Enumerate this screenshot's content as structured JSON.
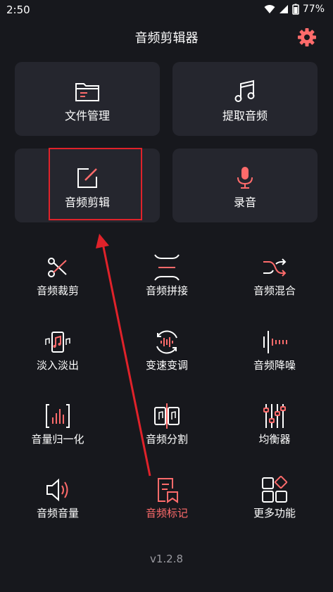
{
  "status": {
    "time": "2:50",
    "battery": "77%"
  },
  "app": {
    "title": "音频剪辑器"
  },
  "cards": [
    {
      "label": "文件管理"
    },
    {
      "label": "提取音频"
    },
    {
      "label": "音频剪辑"
    },
    {
      "label": "录音"
    }
  ],
  "tools": [
    {
      "label": "音频裁剪"
    },
    {
      "label": "音频拼接"
    },
    {
      "label": "音频混合"
    },
    {
      "label": "淡入淡出"
    },
    {
      "label": "变速变调"
    },
    {
      "label": "音频降噪"
    },
    {
      "label": "音量归一化"
    },
    {
      "label": "音频分割"
    },
    {
      "label": "均衡器"
    },
    {
      "label": "音频音量"
    },
    {
      "label": "音频标记"
    },
    {
      "label": "更多功能"
    }
  ],
  "footer": {
    "version": "v1.2.8"
  },
  "colors": {
    "accent": "#ff6b6b",
    "highlight": "#e0222a",
    "background": "#17181d",
    "card": "#25262e"
  }
}
